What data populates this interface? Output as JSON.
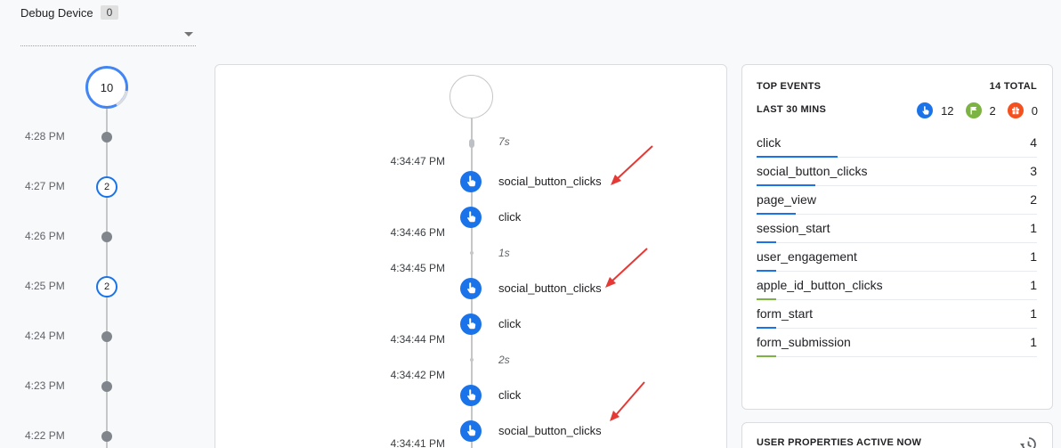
{
  "debug_device": {
    "label": "Debug Device",
    "count": "0"
  },
  "minutes": {
    "top_count": "10",
    "rows": [
      {
        "time": "4:28 PM",
        "count": ""
      },
      {
        "time": "4:27 PM",
        "count": "2"
      },
      {
        "time": "4:26 PM",
        "count": ""
      },
      {
        "time": "4:25 PM",
        "count": "2"
      },
      {
        "time": "4:24 PM",
        "count": ""
      },
      {
        "time": "4:23 PM",
        "count": ""
      },
      {
        "time": "4:22 PM",
        "count": ""
      }
    ]
  },
  "stream": {
    "gaps": [
      "7s",
      "1s",
      "2s"
    ],
    "timestamps": [
      "4:34:47 PM",
      "4:34:46 PM",
      "4:34:45 PM",
      "4:34:44 PM",
      "4:34:42 PM",
      "4:34:41 PM"
    ],
    "events": [
      {
        "name": "social_button_clicks",
        "icon": "touch-icon"
      },
      {
        "name": "click",
        "icon": "touch-icon"
      },
      {
        "name": "social_button_clicks",
        "icon": "touch-icon"
      },
      {
        "name": "click",
        "icon": "touch-icon"
      },
      {
        "name": "click",
        "icon": "touch-icon"
      },
      {
        "name": "social_button_clicks",
        "icon": "touch-icon"
      }
    ],
    "annotation_color": "#e53935"
  },
  "top_events": {
    "title": "TOP EVENTS",
    "total": "14 TOTAL",
    "subtitle": "LAST 30 MINS",
    "stats": [
      {
        "icon": "touch-icon",
        "color": "#1a73e8",
        "value": "12"
      },
      {
        "icon": "flag-icon",
        "color": "#7cb342",
        "value": "2"
      },
      {
        "icon": "gift-icon",
        "color": "#f4511e",
        "value": "0"
      }
    ],
    "rows": [
      {
        "name": "click",
        "value": "4",
        "share": 0.29,
        "color": "#1a73e8"
      },
      {
        "name": "social_button_clicks",
        "value": "3",
        "share": 0.21,
        "color": "#1a73e8"
      },
      {
        "name": "page_view",
        "value": "2",
        "share": 0.14,
        "color": "#1a73e8"
      },
      {
        "name": "session_start",
        "value": "1",
        "share": 0.07,
        "color": "#1a73e8"
      },
      {
        "name": "user_engagement",
        "value": "1",
        "share": 0.07,
        "color": "#1a73e8"
      },
      {
        "name": "apple_id_button_clicks",
        "value": "1",
        "share": 0.07,
        "color": "#7cb342"
      },
      {
        "name": "form_start",
        "value": "1",
        "share": 0.07,
        "color": "#1a73e8"
      },
      {
        "name": "form_submission",
        "value": "1",
        "share": 0.07,
        "color": "#7cb342"
      }
    ]
  },
  "user_properties": {
    "title": "USER PROPERTIES ACTIVE NOW",
    "icon": "history-icon"
  },
  "colors": {
    "accent": "#1a73e8",
    "accent_light": "#4285f4",
    "conversion": "#7cb342",
    "other": "#f4511e"
  }
}
